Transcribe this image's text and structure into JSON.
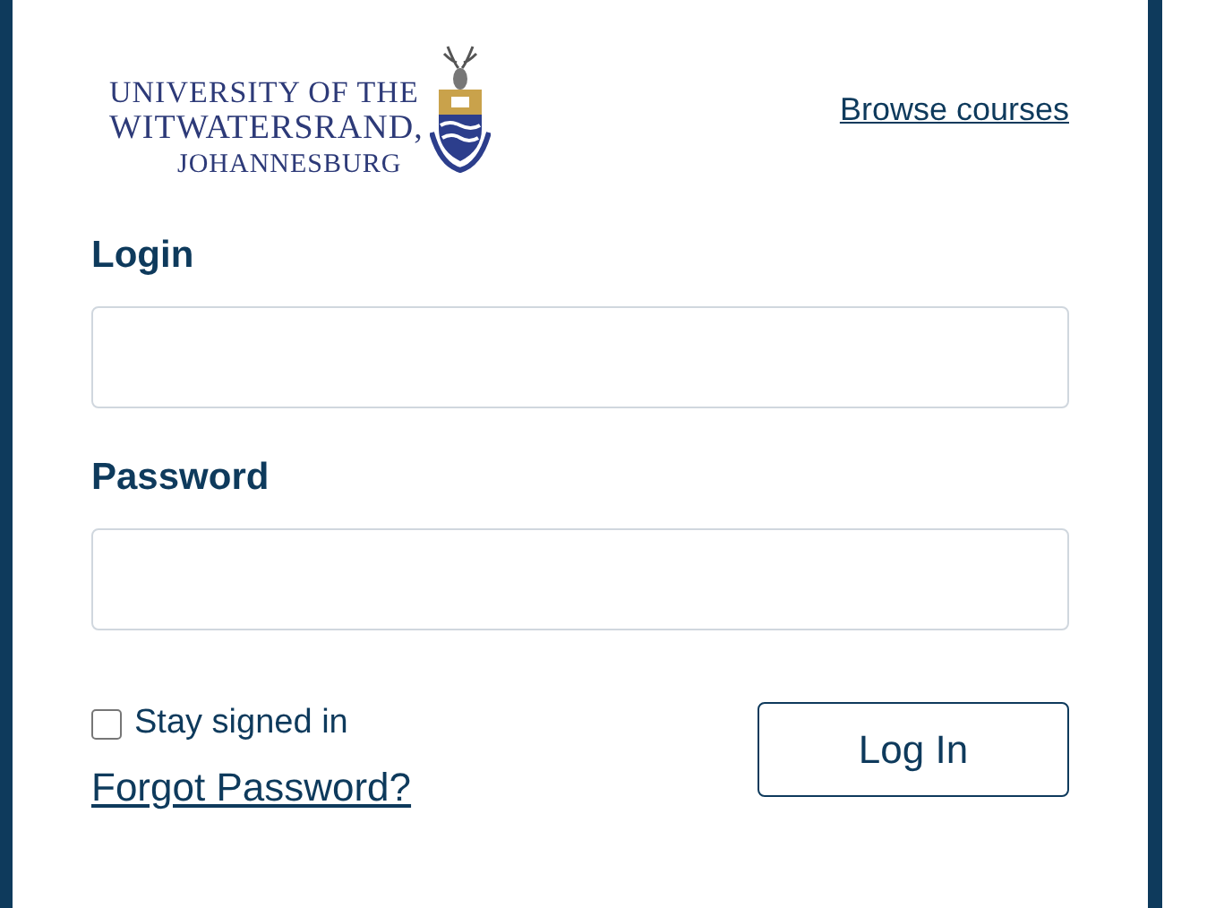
{
  "logo": {
    "lines": [
      "UNIVERSITY OF THE",
      "WITWATERSRAND,",
      "JOHANNESBURG"
    ]
  },
  "browse_link": "Browse courses",
  "fields": [
    {
      "label": "Login"
    },
    {
      "label": "Password"
    }
  ],
  "stay_signed_in": {
    "label": "Stay signed in",
    "checked": false
  },
  "forgot_link": "Forgot Password?",
  "login_button": "Log In"
}
